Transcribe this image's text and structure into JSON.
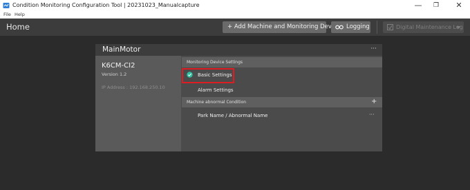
{
  "window": {
    "title": "Condition Monitoring Configuration Tool  |  20231023_Manualcapture",
    "minimize": "—",
    "maximize": "❐",
    "close": "✕"
  },
  "menu": {
    "items": [
      "File",
      "Help"
    ]
  },
  "header": {
    "title": "Home",
    "add_button": "+ Add Machine and Monitoring Device",
    "logging_button": "Logging",
    "disabled_button": "Digital Maintenance Log"
  },
  "card": {
    "title": "MainMotor",
    "more": "···",
    "device": {
      "name": "K6CM-CI2",
      "version": "Version 1.2",
      "ip": "IP Address : 192.168.250.10"
    },
    "monitoring_section": "Monitoring Device Settings",
    "basic_settings": "Basic Settings",
    "alarm_settings": "Alarm Settings",
    "machine_section": "Machine abnormal Condition",
    "add": "+",
    "abnormal_item": "Park Name / Abnormal Name",
    "abnormal_more": "···"
  },
  "colors": {
    "background": "#2b2b2b",
    "header": "#3c3c3c",
    "card": "#4b4b4b",
    "highlight": "#e01b22",
    "check": "#2fbf9f"
  }
}
